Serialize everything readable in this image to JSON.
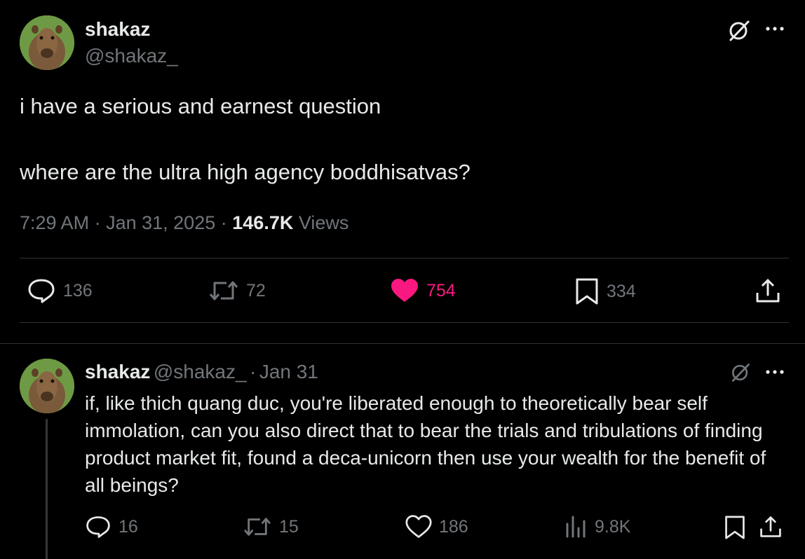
{
  "main_tweet": {
    "display_name": "shakaz",
    "handle": "@shakaz_",
    "text_line1": "i have a serious and earnest question",
    "text_line2": "where are the ultra high agency boddhisatvas?",
    "time": "7:29 AM",
    "date": "Jan 31, 2025",
    "views_count": "146.7K",
    "views_label": "Views",
    "replies": "136",
    "reposts": "72",
    "likes": "754",
    "bookmarks": "334"
  },
  "reply_tweet": {
    "display_name": "shakaz",
    "handle": "@shakaz_",
    "date": "Jan 31",
    "text": "if, like thich quang duc, you're liberated enough to theoretically bear self immolation, can you also direct that to bear the trials and tribulations of finding product market fit, found a deca-unicorn then use your wealth for the benefit of all beings?",
    "replies": "16",
    "reposts": "15",
    "likes": "186",
    "views": "9.8K"
  },
  "separators": {
    "dot": "·"
  },
  "colors": {
    "background": "#000000",
    "text": "#e7e9ea",
    "muted": "#71767b",
    "like_active": "#f91880",
    "divider": "#2f3336"
  },
  "icons": [
    "grok-icon",
    "more-icon",
    "reply-icon",
    "repost-icon",
    "heart-icon",
    "bookmark-icon",
    "share-icon",
    "views-icon"
  ]
}
